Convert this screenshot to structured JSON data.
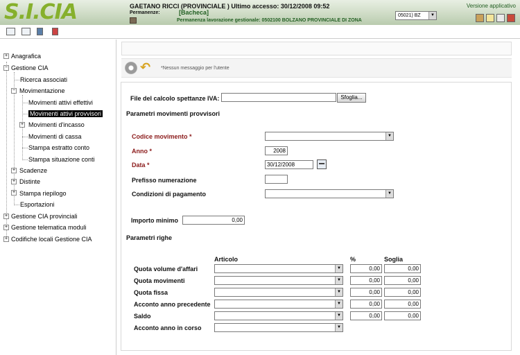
{
  "header": {
    "logo": "S.I.CIA",
    "user_line": "GAETANO RICCI (PROVINCIALE ) Ultimo accesso: 30/12/2008 09:52",
    "perm_label": "Permanenze:",
    "perm_value": "[Bacheca]",
    "gest_line": "Permanenza lavorazione gestionale: 0502100 BOLZANO PROVINCIALE DI ZONA",
    "zone_select": "05021) BZ",
    "version": "Versione applicativo"
  },
  "sidebar": {
    "anagrafica": "Anagrafica",
    "gestione_cia": "Gestione CIA",
    "ricerca_associati": "Ricerca associati",
    "movimentazione": "Movimentazione",
    "mov_attivi_effettivi": "Movimenti attivi effettivi",
    "mov_attivi_provvisori": "Movimenti attivi provvisori",
    "mov_incasso": "Movimenti d'incasso",
    "mov_cassa": "Movimenti di cassa",
    "stampa_estratto": "Stampa estratto conto",
    "stampa_situazione": "Stampa situazione conti",
    "scadenze": "Scadenze",
    "distinte": "Distinte",
    "stampa_riepilogo": "Stampa riepilogo",
    "esportazioni": "Esportazioni",
    "gestione_provinciali": "Gestione CIA provinciali",
    "gestione_telematica": "Gestione telematica moduli",
    "codifiche_locali": "Codifiche locali Gestione CIA"
  },
  "messages": {
    "text": "*Nessun messaggio per l'utente"
  },
  "form": {
    "file_label": "File del calcolo spettanze IVA:",
    "file_value": "",
    "browse_label": "Sfoglia...",
    "section_params": "Parametri movimenti provvisori",
    "codice_label": "Codice movimento *",
    "codice_value": "",
    "anno_label": "Anno *",
    "anno_value": "2008",
    "data_label": "Data *",
    "data_value": "30/12/2008",
    "prefisso_label": "Prefisso numerazione",
    "prefisso_value": "",
    "condizioni_label": "Condizioni di pagamento",
    "condizioni_value": "",
    "importo_label": "Importo minimo",
    "importo_value": "0,00",
    "section_righe": "Parametri righe",
    "col_articolo": "Articolo",
    "col_percent": "%",
    "col_soglia": "Soglia",
    "rows": [
      {
        "label": "Quota volume d'affari",
        "percent": "0,00",
        "soglia": "0,00"
      },
      {
        "label": "Quota movimenti",
        "percent": "0,00",
        "soglia": "0,00"
      },
      {
        "label": "Quota fissa",
        "percent": "0,00",
        "soglia": "0,00"
      },
      {
        "label": "Acconto anno precedente",
        "percent": "0,00",
        "soglia": "0,00"
      },
      {
        "label": "Saldo",
        "percent": "0,00",
        "soglia": "0,00"
      },
      {
        "label": "Acconto anno in corso",
        "percent": "",
        "soglia": ""
      }
    ]
  }
}
